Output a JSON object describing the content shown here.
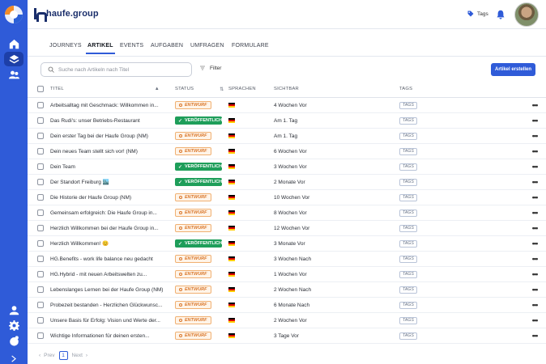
{
  "app": {
    "brand": "haufe.group"
  },
  "header": {
    "tags_label": "Tags"
  },
  "nav": {
    "tabs": [
      {
        "label": "JOURNEYS",
        "active": false
      },
      {
        "label": "ARTIKEL",
        "active": true
      },
      {
        "label": "EVENTS",
        "active": false
      },
      {
        "label": "AUFGABEN",
        "active": false
      },
      {
        "label": "UMFRAGEN",
        "active": false
      },
      {
        "label": "FORMULARE",
        "active": false
      }
    ]
  },
  "toolbar": {
    "search_placeholder": "Suche nach Artikeln nach Titel",
    "filter_label": "Filter",
    "create_label": "Artikel erstellen"
  },
  "table": {
    "columns": {
      "title": "TITEL",
      "status": "STATUS",
      "languages": "SPRACHEN",
      "visible": "SICHTBAR",
      "tags": "TAGS"
    },
    "status_labels": {
      "draft": "ENTWURF",
      "published": "VERÖFFENTLICHT"
    },
    "tag_label": "TAGS",
    "rows": [
      {
        "title": "Arbeitsalltag mit Geschmack: Willkommen in...",
        "status": "draft",
        "visible": "4 Wochen Vor"
      },
      {
        "title": "Das Rudi's: unser Betriebs-Restaurant",
        "status": "published",
        "visible": "Am 1. Tag"
      },
      {
        "title": "Dein erster Tag bei der Haufe Group (NM)",
        "status": "draft",
        "visible": "Am 1. Tag"
      },
      {
        "title": "Dein neues Team stellt sich vor! (NM)",
        "status": "draft",
        "visible": "6 Wochen Vor"
      },
      {
        "title": "Dein Team",
        "status": "published",
        "visible": "3 Wochen Vor"
      },
      {
        "title": "Der Standort Freiburg 🏙️",
        "status": "published",
        "visible": "2 Monate Vor"
      },
      {
        "title": "Die Historie der Haufe Group (NM)",
        "status": "draft",
        "visible": "10 Wochen Vor"
      },
      {
        "title": "Gemeinsam erfolgreich: Die Haufe Group in...",
        "status": "draft",
        "visible": "8 Wochen Vor"
      },
      {
        "title": "Herzlich Willkommen bei der Haufe Group in...",
        "status": "draft",
        "visible": "12 Wochen Vor"
      },
      {
        "title": "Herzlich Willkommen! 😊",
        "status": "published",
        "visible": "3 Monate Vor"
      },
      {
        "title": "HG.Benefits - work life balance neu gedacht",
        "status": "draft",
        "visible": "3 Wochen Nach"
      },
      {
        "title": "HG.Hybrid - mit neuen Arbeitswelten zu...",
        "status": "draft",
        "visible": "1 Wochen Vor"
      },
      {
        "title": "Lebenslanges Lernen bei der Haufe Group (NM)",
        "status": "draft",
        "visible": "2 Wochen Nach"
      },
      {
        "title": "Probezeit bestanden - Herzlichen Glückwunsc...",
        "status": "draft",
        "visible": "6 Monate Nach"
      },
      {
        "title": "Unsere Basis für Erfolg: Vision und Werte der...",
        "status": "draft",
        "visible": "2 Wochen Vor"
      },
      {
        "title": "Wichtige Informationen für deinen ersten...",
        "status": "draft",
        "visible": "3 Tage Vor"
      }
    ]
  },
  "pagination": {
    "prev": "Prev",
    "current": "1",
    "next": "Next"
  },
  "colors": {
    "accent": "#2f5bd8",
    "draft": "#d9772b",
    "published": "#1e9e5a"
  }
}
